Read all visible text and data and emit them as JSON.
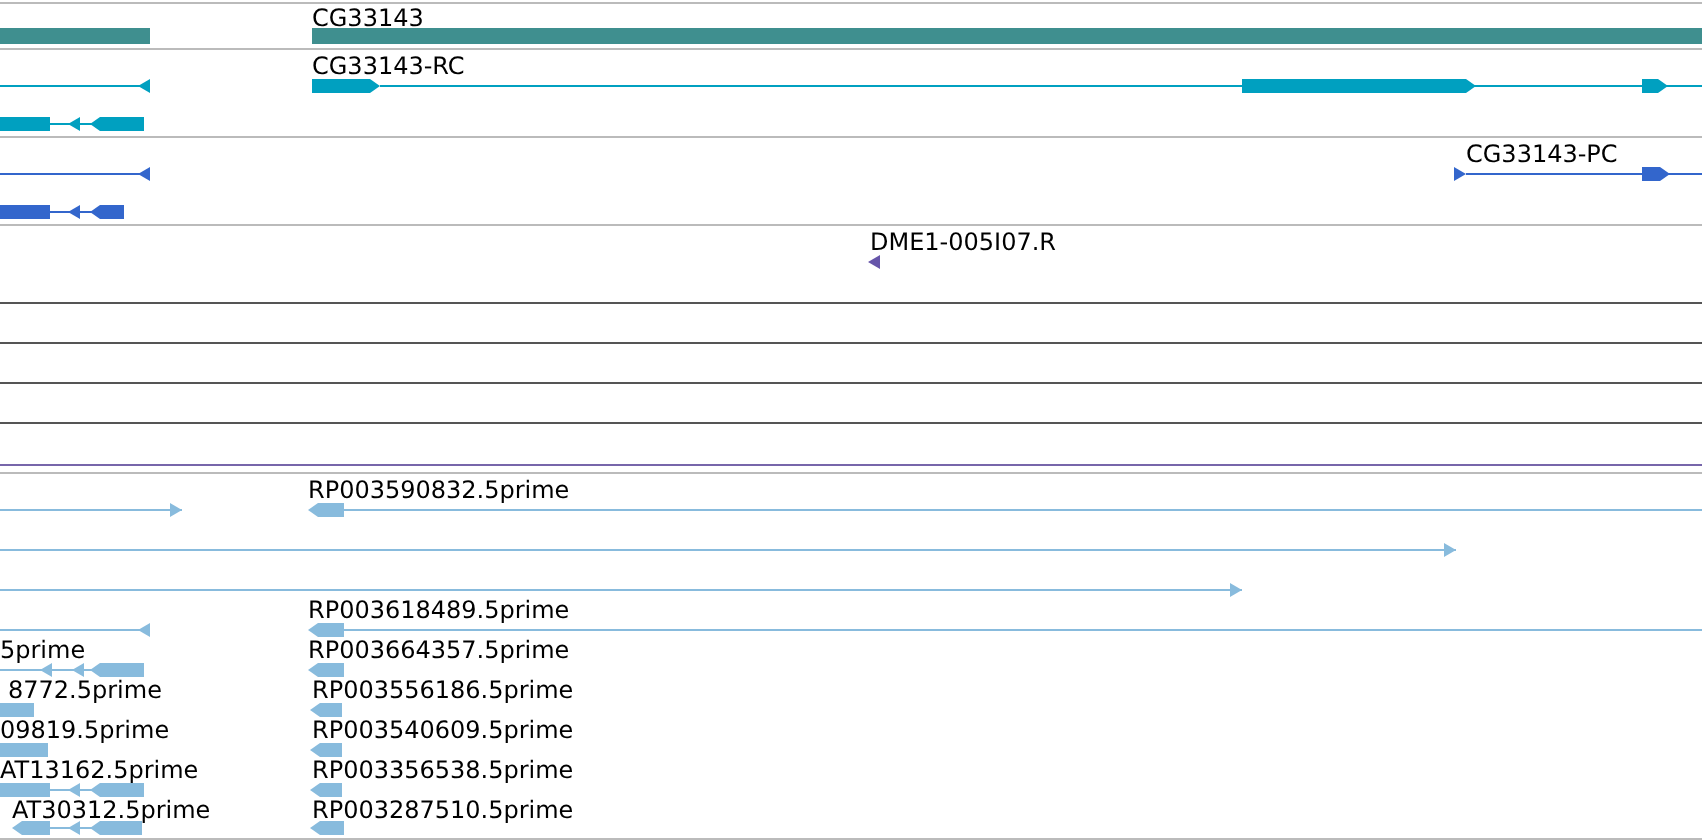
{
  "tracks": [
    {
      "kind": "gene",
      "features": [
        {
          "label": "CG33143"
        }
      ]
    },
    {
      "kind": "transcript",
      "features": [
        {
          "label": "CG33143-RC"
        }
      ]
    },
    {
      "kind": "protein",
      "features": [
        {
          "label": "CG33143-PC"
        }
      ]
    },
    {
      "kind": "est",
      "features": [
        {
          "label": "DME1-005I07.R"
        }
      ]
    },
    {
      "kind": "cdna",
      "features": [
        {
          "label": "RP003590832.5prime"
        },
        {
          "label": "RP003618489.5prime"
        },
        {
          "label": "5prime"
        },
        {
          "label": "RP003664357.5prime"
        },
        {
          "label": "8772.5prime"
        },
        {
          "label": "RP003556186.5prime"
        },
        {
          "label": "09819.5prime"
        },
        {
          "label": "RP003540609.5prime"
        },
        {
          "label": "AT13162.5prime"
        },
        {
          "label": "RP003356538.5prime"
        },
        {
          "label": "AT30312.5prime"
        },
        {
          "label": "RP003287510.5prime"
        }
      ]
    }
  ]
}
